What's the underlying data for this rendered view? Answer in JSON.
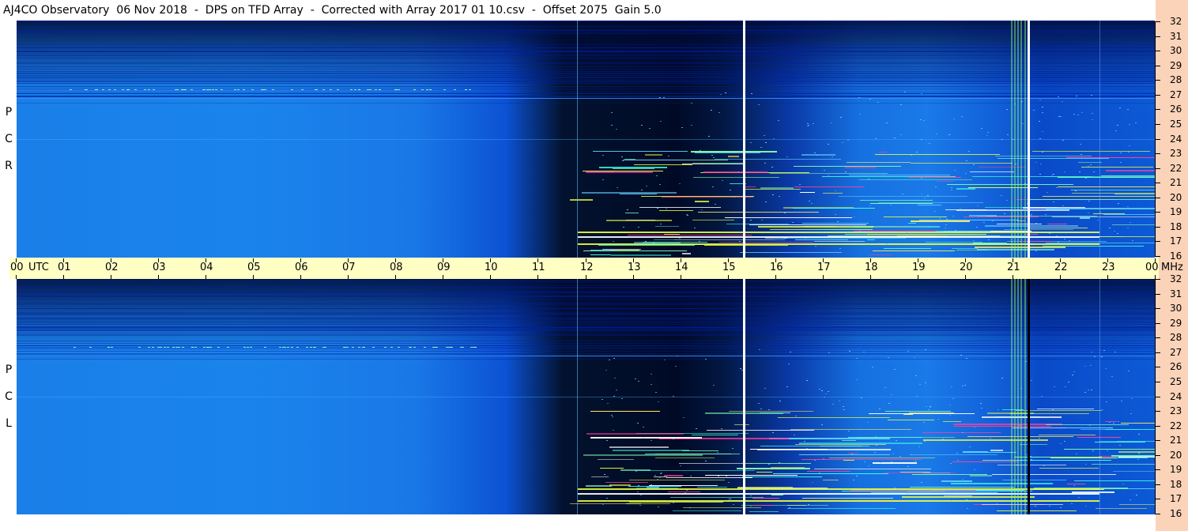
{
  "title": "AJ4CO Observatory  06 Nov 2018  -  DPS on TFD Array  -  Corrected with Array 2017 01 10.csv  -  Offset 2075  Gain 5.0",
  "panels": [
    {
      "name": "RCP",
      "letters": [
        "P",
        "C",
        "R"
      ]
    },
    {
      "name": "LCP",
      "letters": [
        "P",
        "C",
        "L"
      ]
    }
  ],
  "time_axis": {
    "ticks": [
      "00",
      "01",
      "02",
      "03",
      "04",
      "05",
      "06",
      "07",
      "08",
      "09",
      "10",
      "11",
      "12",
      "13",
      "14",
      "15",
      "16",
      "17",
      "18",
      "19",
      "20",
      "21",
      "22",
      "23",
      "00"
    ],
    "utc_label": "UTC",
    "mhz_label": "MHz"
  },
  "freq_axis": {
    "ticks": [
      "32",
      "31",
      "30",
      "29",
      "28",
      "27",
      "26",
      "25",
      "24",
      "23",
      "22",
      "21",
      "20",
      "19",
      "18",
      "17",
      "16"
    ]
  },
  "colors": {
    "axis_band": "#ffffc4",
    "side_strip": "#fbd3b8",
    "spectrogram_dark": "#000c2c",
    "spectrogram_mid": "#0a4ad8",
    "spectrogram_light": "#1a90f0"
  }
}
